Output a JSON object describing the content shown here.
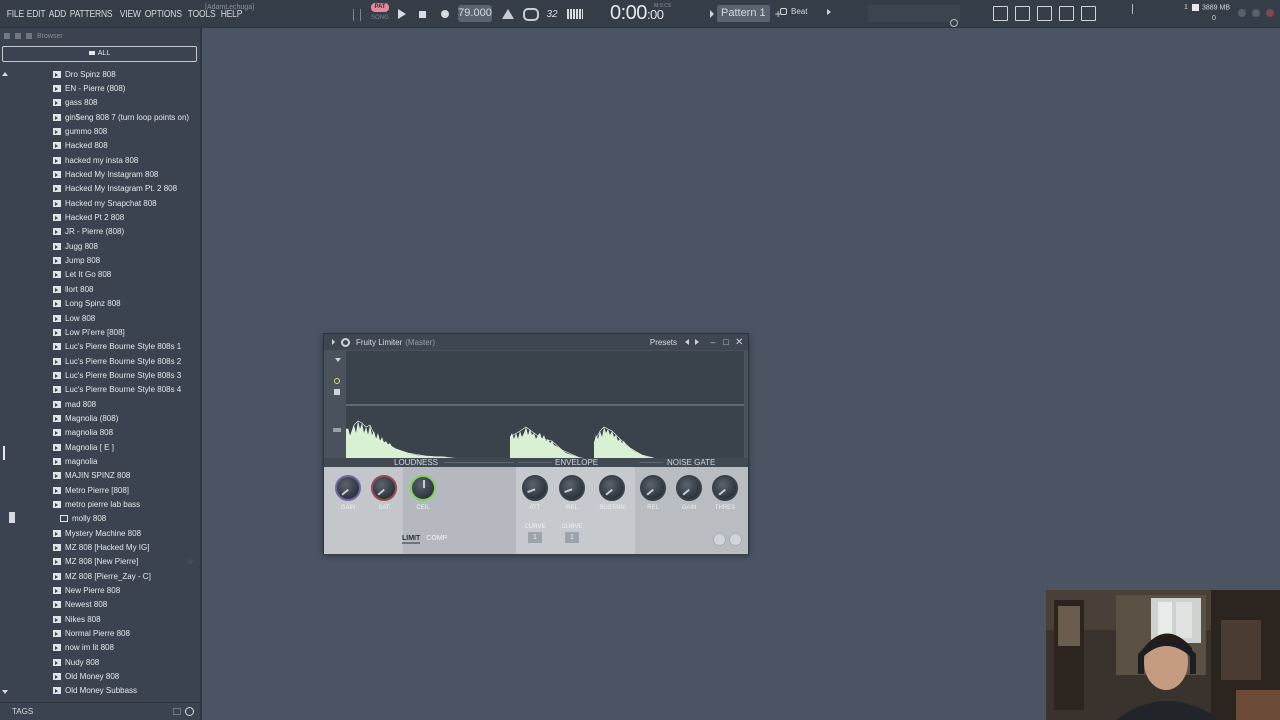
{
  "menu": [
    "FILE",
    "EDIT",
    "ADD",
    "PATTERNS",
    "VIEW",
    "OPTIONS",
    "TOOLS",
    "HELP"
  ],
  "hint": "[AdamLechuga]",
  "transport": {
    "pat_label": "PAT",
    "song_label": "SONG",
    "tempo": "79.000",
    "time_main": "0:00",
    "time_sub": ":00",
    "time_unit": "M:S:CS",
    "step_label": "32"
  },
  "pattern": {
    "name": "Pattern 1",
    "plus": "+"
  },
  "beat": "Beat",
  "cpu": {
    "voices": "1"
  },
  "memory": {
    "value": "3889 MB",
    "count": "0"
  },
  "browser": {
    "title": "Browser",
    "all_label": "ALL",
    "items": [
      "Dro Spinz 808",
      "EN - Pierre (808)",
      "gass 808",
      "gin$eng 808 7 (turn loop points on)",
      "gummo 808",
      "Hacked 808",
      "hacked my insta 808",
      "Hacked My Instagram 808",
      "Hacked My Instagram Pt. 2 808",
      "Hacked my Snapchat 808",
      "Hacked Pt 2 808",
      "JR - Pierre (808)",
      "Jugg 808",
      "Jump 808",
      "Let It Go 808",
      "llort 808",
      "Long Spinz 808",
      "Low 808",
      "Low Pi'erre [808]",
      "Luc's Pierre Bourne Style 808s 1",
      "Luc's Pierre Bourne Style 808s 2",
      "Luc's Pierre Bourne Style 808s 3",
      "Luc's Pierre Bourne Style 808s 4",
      "mad 808",
      "Magnolia (808)",
      "magnolia 808",
      "Magnolia [ E ]",
      "magnolia",
      "MAJIN SPINZ 808",
      "Metro Pierre [808]",
      "metro pierre lab bass",
      "molly 808",
      "Mystery Machine 808",
      "MZ 808 [Hacked My IG]",
      "MZ 808 [New Pierre]",
      "MZ 808 [Pierre_Zay - C]",
      "New Pierre 808",
      "Newest 808",
      "Nikes 808",
      "Normal Pierre 808",
      "now im lit 808",
      "Nudy 808",
      "Old Money 808",
      "Old Money Subbass"
    ],
    "star": "☆",
    "tags_label": "TAGS"
  },
  "limiter": {
    "title": "Fruity Limiter",
    "subtitle": "(Master)",
    "presets_label": "Presets",
    "minimize": "–",
    "maximize": "□",
    "close": "✕",
    "sections": {
      "loudness": "LOUDNESS",
      "envelope": "ENVELOPE",
      "noise_gate": "NOISE GATE"
    },
    "knobs": {
      "gain": "GAIN",
      "sat": "SAT",
      "ceil": "CEIL",
      "att": "ATT",
      "rel": "REL",
      "sustain": "SUSTAIN",
      "gate_rel": "REL",
      "gate_gain": "GAIN",
      "thres": "THRES"
    },
    "curve_label": "CURVE",
    "curve_att_value": "1",
    "curve_rel_value": "1",
    "mode_limit": "LIMIT",
    "mode_comp": "COMP"
  },
  "colors": {
    "background": "#4b5463",
    "waveform": "#d9f0d3",
    "ceil_knob": "#7fd25a",
    "pat_badge": "#e38a9a"
  }
}
